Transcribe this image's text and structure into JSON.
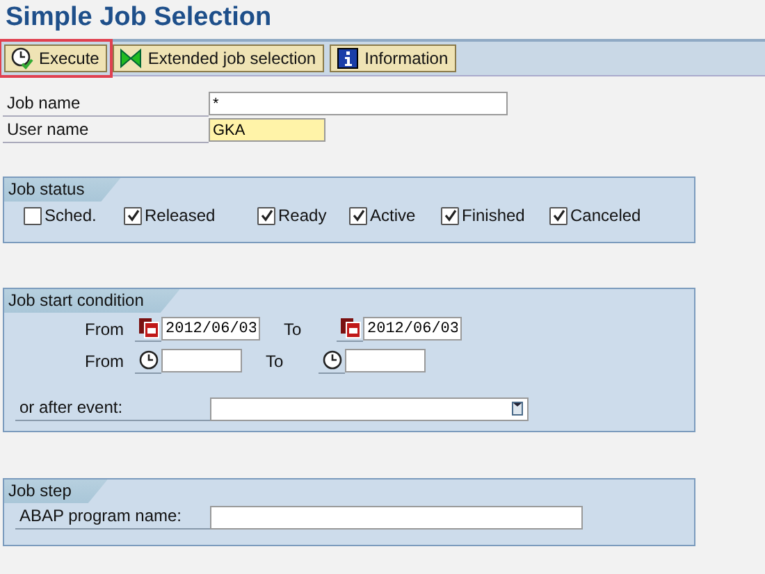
{
  "title": "Simple Job Selection",
  "toolbar": [
    {
      "label": "Execute",
      "kind": "execute",
      "highlighted": true
    },
    {
      "label": "Extended job selection",
      "kind": "extended",
      "highlighted": false
    },
    {
      "label": "Information",
      "kind": "information",
      "highlighted": false
    }
  ],
  "fields": [
    {
      "label": "Job name",
      "value": "*",
      "required": false
    },
    {
      "label": "User name",
      "value": "GKA",
      "required": true
    }
  ],
  "job_status": {
    "title": "Job status",
    "items": [
      {
        "label": "Sched.",
        "checked": false
      },
      {
        "label": "Released",
        "checked": true
      },
      {
        "label": "Ready",
        "checked": true
      },
      {
        "label": "Active",
        "checked": true
      },
      {
        "label": "Finished",
        "checked": true
      },
      {
        "label": "Canceled",
        "checked": true
      }
    ]
  },
  "start_condition": {
    "title": "Job start condition",
    "rows": [
      {
        "kind": "date",
        "from_label": "From",
        "from": "2012/06/03",
        "to_label": "To",
        "to": "2012/06/03"
      },
      {
        "kind": "time",
        "from_label": "From",
        "from": "",
        "to_label": "To",
        "to": ""
      }
    ],
    "event_label": "or after event:"
  },
  "job_step": {
    "title": "Job step",
    "program_label": "ABAP program name:"
  }
}
